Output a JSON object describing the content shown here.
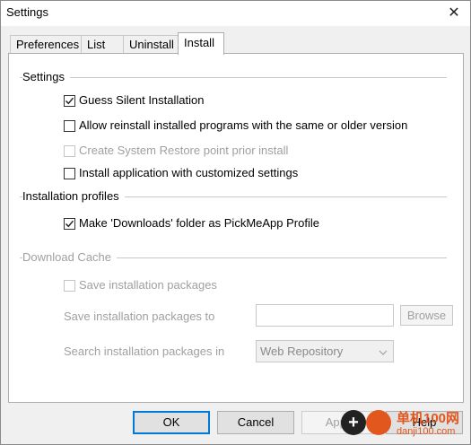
{
  "window": {
    "title": "Settings",
    "close_glyph": "✕"
  },
  "tabs": [
    {
      "label": "Preferences",
      "active": false
    },
    {
      "label": "List",
      "active": false
    },
    {
      "label": "Uninstall",
      "active": false
    },
    {
      "label": "Install",
      "active": true
    }
  ],
  "settings_group": {
    "label": "Settings",
    "options": [
      {
        "label": "Guess Silent Installation",
        "checked": true,
        "enabled": true
      },
      {
        "label": "Allow reinstall installed programs with the same or older version",
        "checked": false,
        "enabled": true
      },
      {
        "label": "Create System Restore point prior install",
        "checked": false,
        "enabled": false
      },
      {
        "label": "Install application with customized settings",
        "checked": false,
        "enabled": true
      }
    ]
  },
  "profiles_group": {
    "label": "Installation profiles",
    "options": [
      {
        "label": "Make 'Downloads' folder as PickMeApp Profile",
        "checked": true,
        "enabled": true
      }
    ]
  },
  "cache_group": {
    "label": "Download Cache",
    "save_packages": {
      "label": "Save installation packages",
      "checked": false,
      "enabled": false
    },
    "save_to_label": "Save installation packages to",
    "save_to_value": "",
    "browse_label": "Browse",
    "search_label": "Search installation packages in",
    "search_value": "Web Repository"
  },
  "buttons": {
    "ok": "OK",
    "cancel": "Cancel",
    "apply": "Apply",
    "help": "Help"
  },
  "watermark": {
    "text": "单机100网",
    "sub": "danji100.com"
  }
}
